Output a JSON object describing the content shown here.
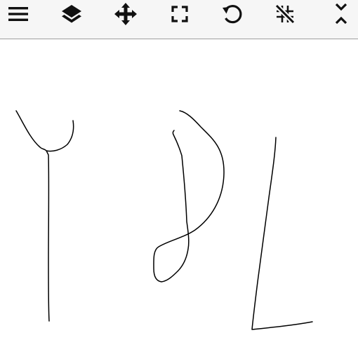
{
  "toolbar": {
    "buttons": [
      {
        "icon": "hamburger-menu-icon",
        "tooltip": ""
      },
      {
        "icon": "layers-icon",
        "tooltip": ""
      },
      {
        "icon": "move-arrows-icon",
        "tooltip": ""
      },
      {
        "icon": "fullscreen-icon",
        "tooltip": ""
      },
      {
        "icon": "undo-icon",
        "tooltip": ""
      },
      {
        "icon": "no-grid-icon",
        "tooltip": ""
      },
      {
        "icon": "collapse-expand-icon",
        "tooltip": ""
      }
    ],
    "icon_color": "#111111"
  },
  "canvas": {
    "background": "#ffffff",
    "stroke_color": "#000000",
    "strokes": [
      "stroke-y",
      "stroke-loop",
      "stroke-l"
    ]
  }
}
